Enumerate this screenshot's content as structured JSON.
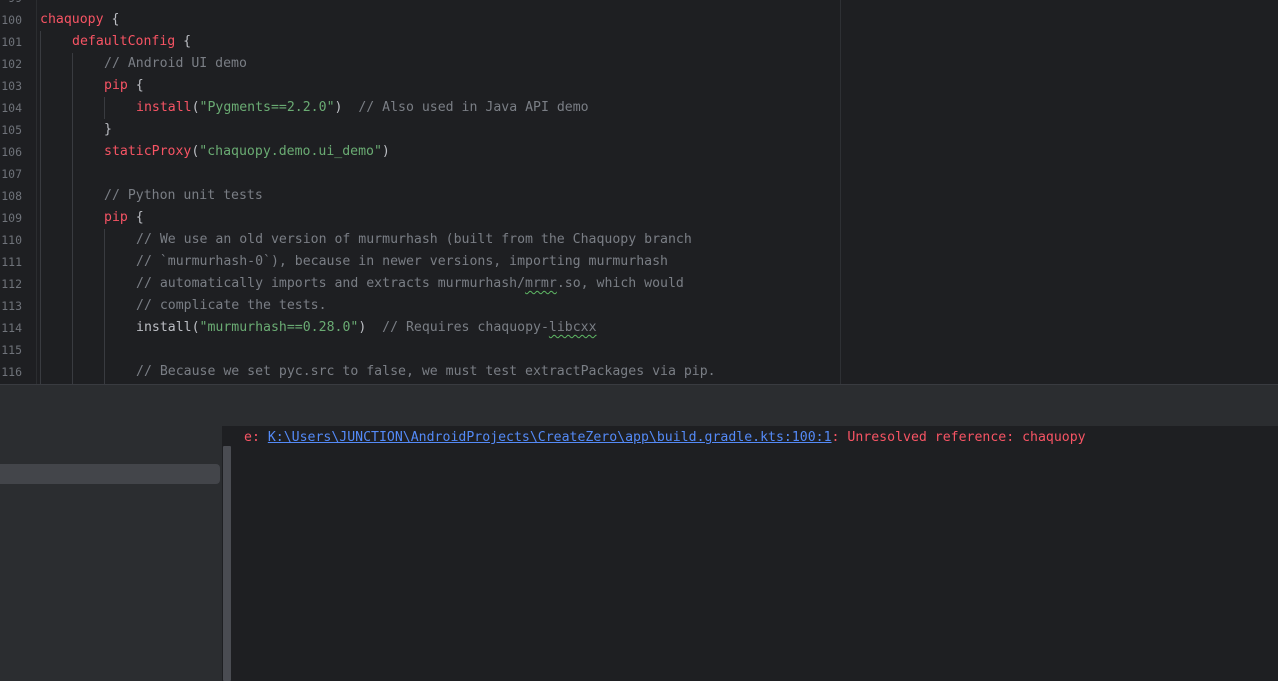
{
  "editor": {
    "line_numbers": [
      "100",
      "101",
      "102",
      "103",
      "104",
      "105",
      "106",
      "107",
      "108",
      "109",
      "110",
      "111",
      "112",
      "113",
      "114",
      "115",
      "116"
    ],
    "lines": {
      "l100": {
        "kw": "chaquopy",
        "brace": " {"
      },
      "l101": {
        "kw": "defaultConfig",
        "brace": " {"
      },
      "l102": {
        "comment": "// Android UI demo"
      },
      "l103": {
        "kw": "pip",
        "brace": " {"
      },
      "l104": {
        "fn": "install",
        "open": "(",
        "str": "\"Pygments==2.2.0\"",
        "close": ")",
        "comment": "  // Also used in Java API demo"
      },
      "l105": {
        "brace": "}"
      },
      "l106": {
        "fn": "staticProxy",
        "open": "(",
        "str": "\"chaquopy.demo.ui_demo\"",
        "close": ")"
      },
      "l108": {
        "comment": "// Python unit tests"
      },
      "l109": {
        "kw": "pip",
        "brace": " {"
      },
      "l110": {
        "comment": "// We use an old version of murmurhash (built from the Chaquopy branch"
      },
      "l111": {
        "comment": "// `murmurhash-0`), because in newer versions, importing murmurhash"
      },
      "l112": {
        "comment_a": "// automatically imports and extracts murmurhash/",
        "typo": "mrmr",
        "comment_b": ".so, which would"
      },
      "l113": {
        "comment": "// complicate the tests."
      },
      "l114": {
        "fn": "install",
        "open": "(",
        "str": "\"murmurhash==0.28.0\"",
        "close": ")",
        "comment_a": "  // Requires chaquopy-",
        "typo": "libcxx"
      },
      "l116": {
        "comment": "// Because we set pyc.src to false, we must test extractPackages via pip."
      }
    }
  },
  "build_output": {
    "prefix": "e: ",
    "file_link": "K:\\Users\\JUNCTION\\AndroidProjects\\CreateZero\\app\\build.gradle.kts:100:1",
    "message": ": Unresolved reference: chaquopy"
  },
  "colors": {
    "background": "#1e1f22",
    "keyword": "#f75464",
    "string": "#6aab73",
    "comment": "#7a7e85",
    "link": "#548af7",
    "error": "#f75464"
  }
}
